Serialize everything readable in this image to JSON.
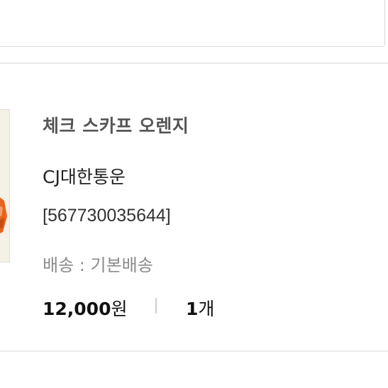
{
  "item": {
    "name": "체크 스카프 오렌지",
    "courier": "CJ대한통운",
    "tracking_number": "[567730035644]",
    "shipping": "배송 : 기본배송",
    "price_amount": "12,000",
    "price_unit": "원",
    "quantity_number": "1",
    "quantity_unit": "개"
  },
  "colors": {
    "thumb_background": "#f6f1e6",
    "thumb_accent": "#e8641e",
    "divider": "#e9e9e9"
  }
}
